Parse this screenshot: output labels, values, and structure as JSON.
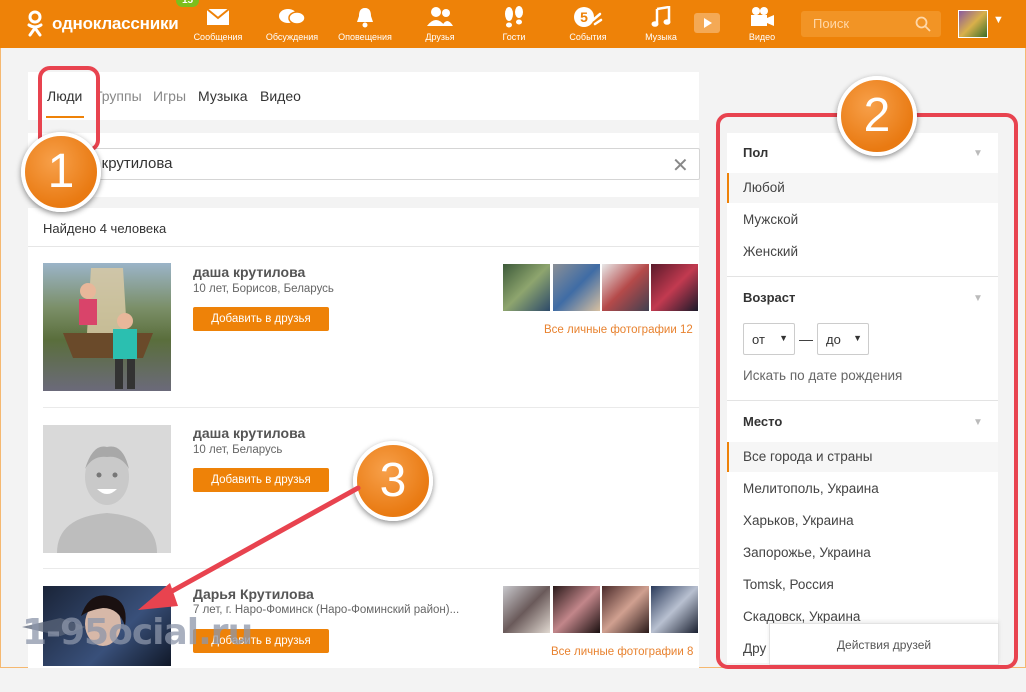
{
  "topbar": {
    "logo_text": "одноклассники",
    "badge": "15",
    "nav": [
      {
        "label": "Сообщения",
        "icon": "envelope-icon"
      },
      {
        "label": "Обсуждения",
        "icon": "chat-bubbles-icon"
      },
      {
        "label": "Оповещения",
        "icon": "bell-icon"
      },
      {
        "label": "Друзья",
        "icon": "friends-icon"
      },
      {
        "label": "Гости",
        "icon": "footprints-icon"
      },
      {
        "label": "События",
        "icon": "events-icon"
      },
      {
        "label": "Музыка",
        "icon": "music-note-icon"
      },
      {
        "label": "Видео",
        "icon": "video-camera-icon"
      }
    ],
    "search_placeholder": "Поиск"
  },
  "tabs": [
    "Люди",
    "Группы",
    "Игры",
    "Музыка",
    "Видео"
  ],
  "search": {
    "value": "даша крутилова"
  },
  "results": {
    "found_text": "Найдено 4 человека",
    "people": [
      {
        "name": "даша крутилова",
        "info": "10 лет, Борисов, Беларусь",
        "add_label": "Добавить в друзья",
        "all_photos": "Все личные фотографии 12"
      },
      {
        "name": "даша крутилова",
        "info": "10 лет, Беларусь",
        "add_label": "Добавить в друзья"
      },
      {
        "name": "Дарья Крутилова",
        "info": "7 лет, г. Наро-Фоминск (Наро-Фоминский район)...",
        "add_label": "Добавить в друзья",
        "all_photos": "Все личные фотографии 8"
      }
    ]
  },
  "filters": {
    "gender": {
      "title": "Пол",
      "options": [
        "Любой",
        "Мужской",
        "Женский"
      ],
      "selected": "Любой"
    },
    "age": {
      "title": "Возраст",
      "from": "от",
      "to": "до",
      "birthdate_link": "Искать по дате рождения"
    },
    "place": {
      "title": "Место",
      "options": [
        "Все города и страны",
        "Мелитополь, Украина",
        "Харьков, Украина",
        "Запорожье, Украина",
        "Tomsk, Россия",
        "Скадовск, Украина",
        "Дру"
      ],
      "selected": "Все города и страны"
    }
  },
  "friends_actions": "Действия друзей",
  "annotations": [
    "1",
    "2",
    "3"
  ],
  "watermark": "1-95ocial.ru",
  "colors": {
    "brand": "#ee8208",
    "highlight": "#e8434f",
    "bubble": "#ee8a20"
  }
}
